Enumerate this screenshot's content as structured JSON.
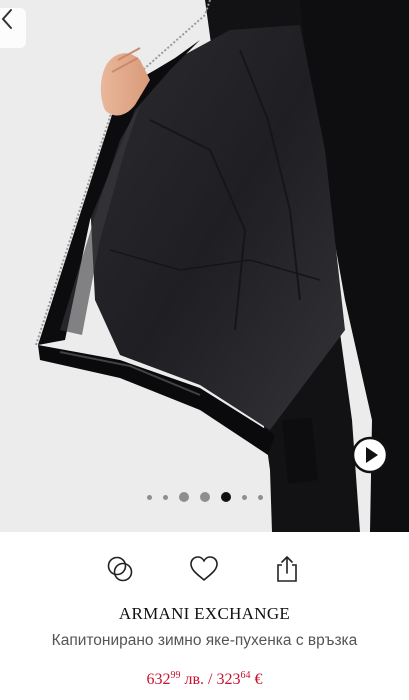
{
  "gallery": {
    "back_icon": "chevron-left-icon",
    "play_icon": "play-icon",
    "dots_count": 7,
    "active_dot": 4
  },
  "actions": {
    "compare_icon": "compare-icon",
    "wishlist_icon": "heart-icon",
    "share_icon": "share-icon"
  },
  "product": {
    "brand": "ARMANI EXCHANGE",
    "name": "Капитонирано зимно яке-пухенка с връзка",
    "price_bgn_main": "632",
    "price_bgn_cents": "99",
    "price_bgn_currency": " лв. / ",
    "price_eur_main": "323",
    "price_eur_cents": "64",
    "price_eur_currency": " €"
  },
  "colors": {
    "price": "#c8102e",
    "active_dot": "#111111",
    "inactive_dot": "#8e8e8e"
  }
}
